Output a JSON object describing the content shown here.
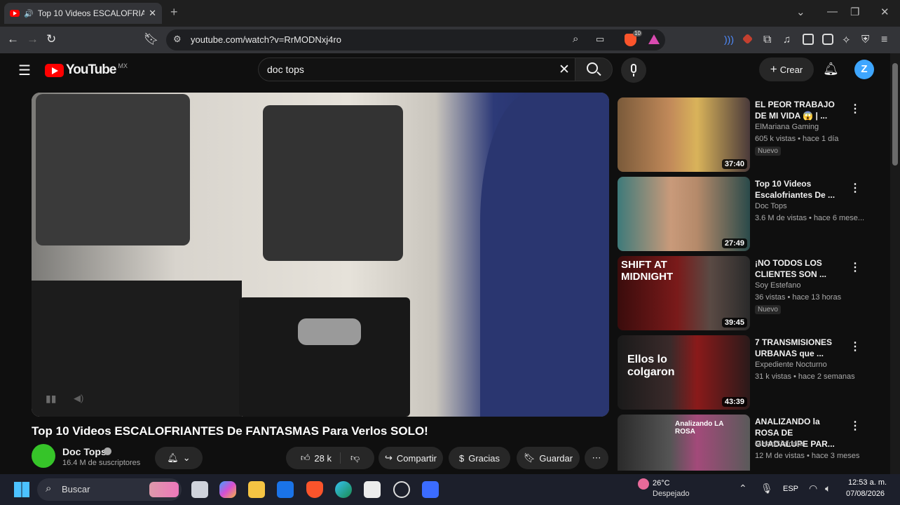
{
  "browser": {
    "tab_title": "Top 10 Videos ESCALOFRIANTES",
    "url": "youtube.com/watch?v=RrMODNxj4ro",
    "new_tab": "+",
    "ext_badge": "10"
  },
  "youtube": {
    "logo_text": "YouTube",
    "region": "MX",
    "search_value": "doc tops",
    "create_label": "Crear",
    "avatar_letter": "Z"
  },
  "video": {
    "title": "Top 10 Videos ESCALOFRIANTES De FANTASMAS Para Verlos SOLO!",
    "channel": "Doc Tops",
    "subscribers": "16.4 M de suscriptores",
    "likes": "28 k",
    "share": "Compartir",
    "thanks": "Gracias",
    "save": "Guardar"
  },
  "recommendations": [
    {
      "title": "EL PEOR TRABAJO DE MI VIDA 😱 | ...",
      "channel": "ElMariana Gaming",
      "meta": "605 k vistas • hace 1 día",
      "badge": "Nuevo",
      "duration": "37:40"
    },
    {
      "title": "Top 10 Videos Escalofriantes De ...",
      "channel": "Doc Tops",
      "meta": "3.6 M de vistas • hace 6 mese...",
      "badge": "",
      "duration": "27:49"
    },
    {
      "title": "¡NO TODOS LOS CLIENTES SON ...",
      "channel": "Soy Estefano",
      "meta": "36 vistas • hace 13 horas",
      "badge": "Nuevo",
      "duration": "39:45",
      "thumb_text": "SHIFT AT MIDNIGHT"
    },
    {
      "title": "7 TRANSMISIONES URBANAS que ...",
      "channel": "Expediente Nocturno",
      "meta": "31 k vistas • hace 2 semanas",
      "badge": "",
      "duration": "43:39",
      "thumb_text": "Ellos lo colgaron"
    },
    {
      "title": "ANALIZANDO la ROSA DE GUADALUPE PAR...",
      "channel": "MisaaSinfonia",
      "meta": "12 M de vistas • hace 3 meses",
      "badge": "",
      "duration": "",
      "thumb_text": "Analizando LA ROSA"
    }
  ],
  "taskbar": {
    "search_label": "Buscar",
    "temperature": "26°C",
    "weather": "Despejado",
    "language": "ESP",
    "time": "12:53 a. m.",
    "date": "07/08/2026"
  }
}
